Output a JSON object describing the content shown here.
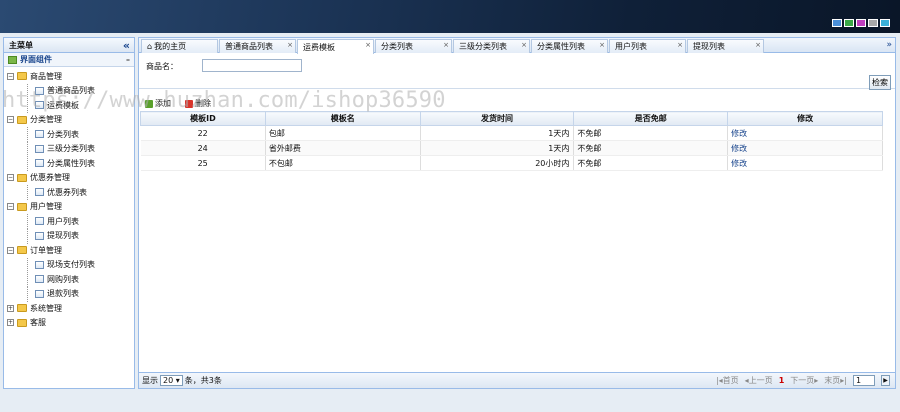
{
  "banner": {
    "swatches": [
      "#4a8fd8",
      "#3aa848",
      "#c040c0",
      "#a8a8a8",
      "#3ab0d8"
    ]
  },
  "watermark": "https://www.huzhan.com/ishop36590",
  "sidebar": {
    "title": "主菜单",
    "collapse_icon": "double-chevron-left-icon",
    "section": "界面组件",
    "groups": [
      {
        "label": "商品管理",
        "items": [
          "普通商品列表",
          "运费模板"
        ]
      },
      {
        "label": "分类管理",
        "items": [
          "分类列表",
          "三级分类列表",
          "分类属性列表"
        ]
      },
      {
        "label": "优惠券管理",
        "items": [
          "优惠券列表"
        ]
      },
      {
        "label": "用户管理",
        "items": [
          "用户列表",
          "提现列表"
        ]
      },
      {
        "label": "订单管理",
        "items": [
          "现场支付列表",
          "网购列表",
          "退款列表"
        ]
      },
      {
        "label": "系统管理",
        "items": []
      },
      {
        "label": "客服",
        "items": []
      }
    ]
  },
  "tabs": [
    {
      "label": "我的主页",
      "closable": false
    },
    {
      "label": "普通商品列表",
      "closable": true
    },
    {
      "label": "运费模板",
      "closable": true,
      "active": true
    },
    {
      "label": "分类列表",
      "closable": true
    },
    {
      "label": "三级分类列表",
      "closable": true
    },
    {
      "label": "分类属性列表",
      "closable": true
    },
    {
      "label": "用户列表",
      "closable": true
    },
    {
      "label": "提现列表",
      "closable": true
    }
  ],
  "query": {
    "label": "商品名：",
    "value": "",
    "search_label": "检索"
  },
  "toolbar": {
    "add_label": "添加",
    "delete_label": "删除"
  },
  "table": {
    "columns": [
      "模板ID",
      "模板名",
      "发货时间",
      "是否免邮",
      "修改"
    ],
    "rows": [
      {
        "id": "22",
        "name": "包邮",
        "time": "1天内",
        "free": "不免邮",
        "edit": "修改"
      },
      {
        "id": "24",
        "name": "省外邮费",
        "time": "1天内",
        "free": "不免邮",
        "edit": "修改"
      },
      {
        "id": "25",
        "name": "不包邮",
        "time": "20小时内",
        "free": "不免邮",
        "edit": "修改"
      }
    ]
  },
  "pager": {
    "show_label": "显示",
    "page_size": "20",
    "summary": "条，共3条",
    "first": "首页",
    "prev": "上一页",
    "current": "1",
    "next": "下一页",
    "last": "末页",
    "page_input": "1"
  }
}
